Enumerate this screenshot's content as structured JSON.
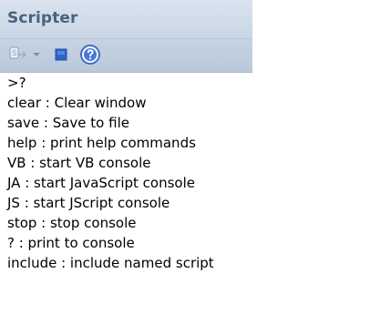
{
  "window": {
    "title": "Scripter"
  },
  "toolbar": {
    "run_icon": "run-script-icon",
    "dropdown_icon": "dropdown-arrow-icon",
    "stop_icon": "stop-icon",
    "help_icon": "help-icon"
  },
  "console": {
    "lines": [
      ">?",
      "clear : Clear window",
      "save : Save to file",
      "help : print help commands",
      "VB : start VB console",
      "JA : start JavaScript console",
      "JS : start JScript console",
      "stop : stop console",
      "? : print to console",
      "include : include named script"
    ]
  },
  "colors": {
    "title_text": "#49627d",
    "titlebar_bg": "#d9e3ef",
    "toolbar_bg": "#c7d3e2",
    "stop_blue": "#2e63c6",
    "help_blue": "#4b78d9"
  }
}
